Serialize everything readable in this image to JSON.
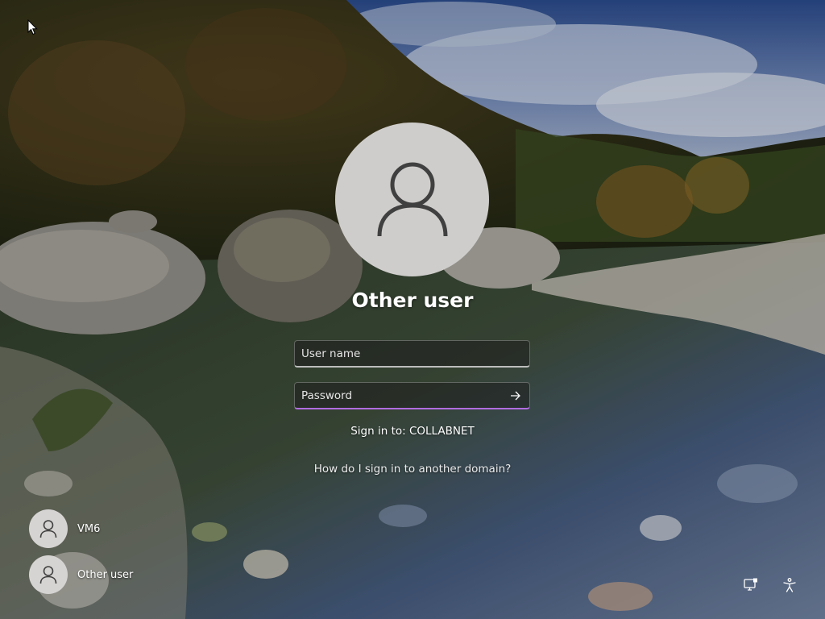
{
  "login": {
    "username_title": "Other user",
    "username_field": {
      "placeholder": "User name",
      "value": ""
    },
    "password_field": {
      "placeholder": "Password",
      "value": ""
    },
    "sign_in_to": "Sign in to: COLLABNET",
    "other_domain_link": "How do I sign in to another domain?"
  },
  "user_tiles": [
    {
      "label": "VM6"
    },
    {
      "label": "Other user"
    }
  ],
  "icons": {
    "avatar": "user-silhouette-icon",
    "submit": "arrow-right-icon",
    "network": "network-icon",
    "accessibility": "accessibility-icon",
    "cursor": "mouse-pointer-icon"
  },
  "colors": {
    "password_focus_accent": "#b06de0",
    "avatar_background": "#cfcdcb",
    "text": "#ffffff"
  }
}
